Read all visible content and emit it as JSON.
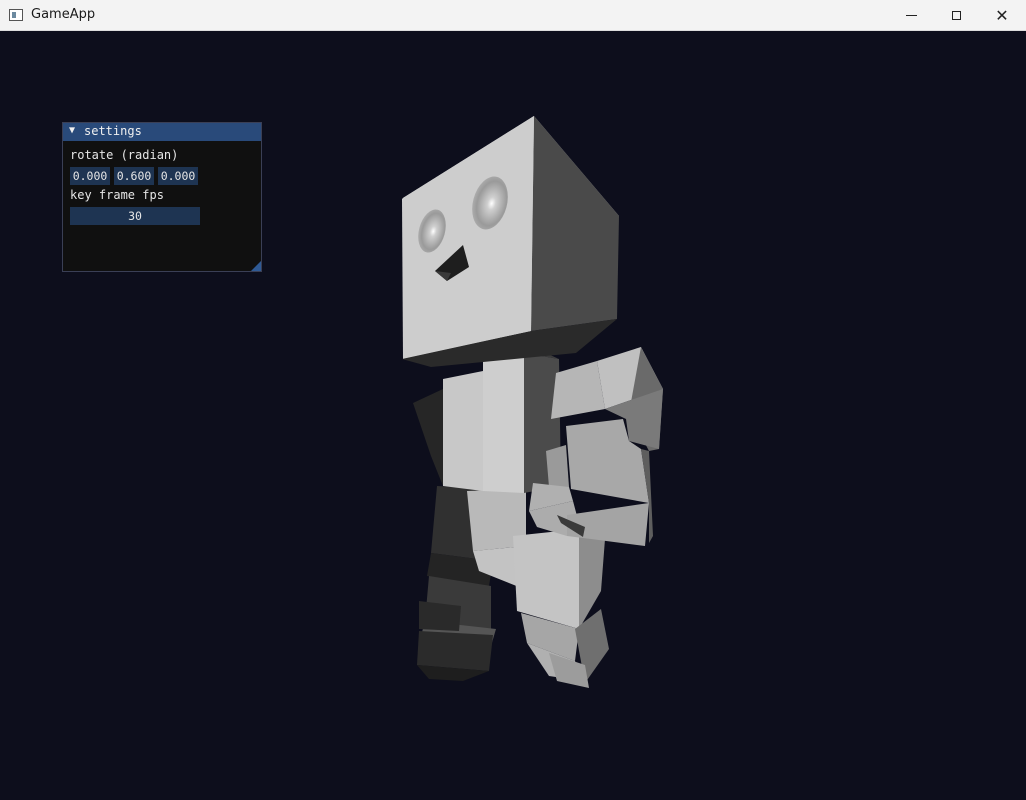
{
  "window": {
    "title": "GameApp",
    "icon": "app-window-icon"
  },
  "title_buttons": {
    "minimize_icon": "minimize-icon",
    "maximize_icon": "maximize-icon",
    "close_icon": "close-icon",
    "close_glyph": "✕"
  },
  "settings_panel": {
    "title": "settings",
    "collapse_arrow": "▼",
    "rotate_label": "rotate (radian)",
    "rotate_values": [
      "0.000",
      "0.600",
      "0.000"
    ],
    "fps_label": "key frame fps",
    "fps_value": "30"
  },
  "colors": {
    "background": "#0d0e1c",
    "panel_header": "#294a7a",
    "field": "#1e3452"
  }
}
